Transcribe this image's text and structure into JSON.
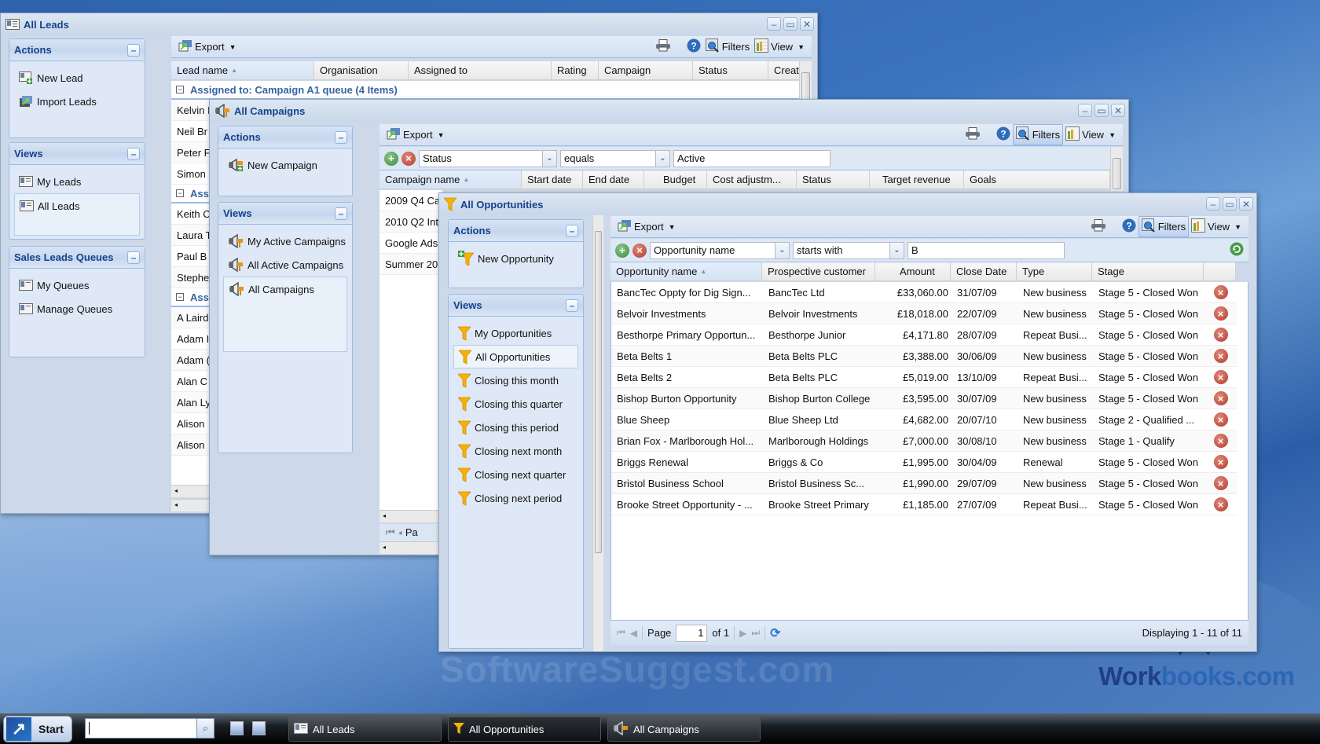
{
  "desktop": {
    "watermark_text": "SoftwareSuggest.com",
    "brand_text_part1": "Work",
    "brand_text_part2": "books.com"
  },
  "leads_window": {
    "title": "All Leads",
    "actions_panel": {
      "title": "Actions",
      "items": [
        {
          "label": "New Lead",
          "icon": "new-lead-icon"
        },
        {
          "label": "Import Leads",
          "icon": "import-icon"
        }
      ]
    },
    "views_panel": {
      "title": "Views",
      "items": [
        {
          "label": "My Leads",
          "icon": "lead-icon"
        },
        {
          "label": "All Leads",
          "icon": "lead-icon",
          "selected": true
        }
      ]
    },
    "queues_panel": {
      "title": "Sales Leads Queues",
      "items": [
        {
          "label": "My Queues",
          "icon": "lead-icon"
        },
        {
          "label": "Manage Queues",
          "icon": "lead-icon"
        }
      ]
    },
    "toolbar": {
      "export_label": "Export",
      "filters_label": "Filters",
      "view_label": "View"
    },
    "columns": [
      "Lead name",
      "Organisation",
      "Assigned to",
      "Rating",
      "Campaign",
      "Status",
      "Create"
    ],
    "groups": [
      {
        "label": "Assigned to: Campaign A1 queue (4 Items)",
        "rows": [
          "Kelvin I",
          "Neil Br",
          "Peter F",
          "Simon"
        ]
      },
      {
        "label": "Assi",
        "rows": [
          "Keith C",
          "Laura T",
          "Paul B",
          "Stephe"
        ]
      },
      {
        "label": "Assi",
        "rows": [
          "A Laird",
          "Adam I",
          "Adam (",
          "Alan C",
          "Alan Ly",
          "Alison",
          "Alison"
        ]
      }
    ]
  },
  "campaigns_window": {
    "title": "All Campaigns",
    "actions_panel": {
      "title": "Actions",
      "items": [
        {
          "label": "New Campaign"
        }
      ]
    },
    "views_panel": {
      "title": "Views",
      "items": [
        {
          "label": "My Active Campaigns"
        },
        {
          "label": "All Active Campaigns"
        },
        {
          "label": "All Campaigns",
          "selected": true
        }
      ]
    },
    "toolbar": {
      "export_label": "Export",
      "filters_label": "Filters",
      "view_label": "View"
    },
    "filter": {
      "field": "Status",
      "operator": "equals",
      "value": "Active"
    },
    "columns": [
      "Campaign name",
      "Start date",
      "End date",
      "Budget",
      "Cost adjustm...",
      "Status",
      "Target revenue",
      "Goals"
    ],
    "rows": [
      "2009 Q4 Ca",
      "2010 Q2 Int",
      "Google Ads",
      "Summer 20"
    ],
    "pager_partial": "Pa"
  },
  "opportunities_window": {
    "title": "All Opportunities",
    "actions_panel": {
      "title": "Actions",
      "items": [
        {
          "label": "New Opportunity"
        }
      ]
    },
    "views_panel": {
      "title": "Views",
      "items": [
        {
          "label": "My Opportunities"
        },
        {
          "label": "All Opportunities",
          "selected": true
        },
        {
          "label": "Closing this month"
        },
        {
          "label": "Closing this quarter"
        },
        {
          "label": "Closing this period"
        },
        {
          "label": "Closing next month"
        },
        {
          "label": "Closing next quarter"
        },
        {
          "label": "Closing next period"
        }
      ]
    },
    "toolbar": {
      "export_label": "Export",
      "filters_label": "Filters",
      "view_label": "View"
    },
    "filter": {
      "field": "Opportunity name",
      "operator": "starts with",
      "value": "B"
    },
    "columns": [
      "Opportunity name",
      "Prospective customer",
      "Amount",
      "Close Date",
      "Type",
      "Stage"
    ],
    "rows": [
      {
        "name": "BancTec Oppty for Dig Sign...",
        "customer": "BancTec Ltd",
        "amount": "£33,060.00",
        "close_date": "31/07/09",
        "type": "New business",
        "stage": "Stage 5 - Closed Won"
      },
      {
        "name": "Belvoir Investments",
        "customer": "Belvoir Investments",
        "amount": "£18,018.00",
        "close_date": "22/07/09",
        "type": "New business",
        "stage": "Stage 5 - Closed Won"
      },
      {
        "name": "Besthorpe Primary Opportun...",
        "customer": "Besthorpe Junior",
        "amount": "£4,171.80",
        "close_date": "28/07/09",
        "type": "Repeat Busi...",
        "stage": "Stage 5 - Closed Won"
      },
      {
        "name": "Beta Belts 1",
        "customer": "Beta Belts PLC",
        "amount": "£3,388.00",
        "close_date": "30/06/09",
        "type": "New business",
        "stage": "Stage 5 - Closed Won"
      },
      {
        "name": "Beta Belts 2",
        "customer": "Beta Belts PLC",
        "amount": "£5,019.00",
        "close_date": "13/10/09",
        "type": "Repeat Busi...",
        "stage": "Stage 5 - Closed Won"
      },
      {
        "name": "Bishop Burton Opportunity",
        "customer": "Bishop Burton College",
        "amount": "£3,595.00",
        "close_date": "30/07/09",
        "type": "New business",
        "stage": "Stage 5 - Closed Won"
      },
      {
        "name": "Blue Sheep",
        "customer": "Blue Sheep Ltd",
        "amount": "£4,682.00",
        "close_date": "20/07/10",
        "type": "New business",
        "stage": "Stage 2 - Qualified ..."
      },
      {
        "name": "Brian Fox - Marlborough Hol...",
        "customer": "Marlborough Holdings",
        "amount": "£7,000.00",
        "close_date": "30/08/10",
        "type": "New business",
        "stage": "Stage 1 - Qualify"
      },
      {
        "name": "Briggs Renewal",
        "customer": "Briggs & Co",
        "amount": "£1,995.00",
        "close_date": "30/04/09",
        "type": "Renewal",
        "stage": "Stage 5 - Closed Won"
      },
      {
        "name": "Bristol Business School",
        "customer": "Bristol Business Sc...",
        "amount": "£1,990.00",
        "close_date": "29/07/09",
        "type": "New business",
        "stage": "Stage 5 - Closed Won"
      },
      {
        "name": "Brooke Street Opportunity - ...",
        "customer": "Brooke Street Primary",
        "amount": "£1,185.00",
        "close_date": "27/07/09",
        "type": "Repeat Busi...",
        "stage": "Stage 5 - Closed Won"
      }
    ],
    "pager": {
      "page_label": "Page",
      "page_value": "1",
      "of_label": "of 1",
      "displaying": "Displaying 1 - 11 of 11"
    }
  },
  "taskbar": {
    "start_label": "Start",
    "search_value": "",
    "tasks": [
      {
        "label": "All Leads"
      },
      {
        "label": "All Opportunities",
        "active": true
      },
      {
        "label": "All Campaigns"
      }
    ]
  }
}
